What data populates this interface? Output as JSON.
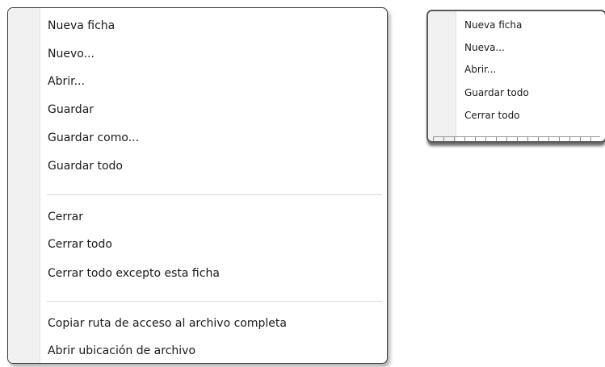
{
  "large_menu": {
    "items": [
      {
        "label": "Nueva ficha"
      },
      {
        "label": "Nuevo..."
      },
      {
        "label": "Abrir..."
      },
      {
        "label": "Guardar"
      },
      {
        "label": "Guardar como..."
      },
      {
        "label": "Guardar todo"
      },
      {
        "label": "Cerrar"
      },
      {
        "label": "Cerrar todo"
      },
      {
        "label": "Cerrar todo excepto esta ficha"
      },
      {
        "label": "Copiar ruta de acceso al archivo completa"
      },
      {
        "label": "Abrir ubicación de archivo"
      }
    ]
  },
  "small_menu": {
    "items": [
      {
        "label": "Nueva ficha"
      },
      {
        "label": "Nueva..."
      },
      {
        "label": "Abrir..."
      },
      {
        "label": "Guardar todo"
      },
      {
        "label": "Cerrar todo"
      }
    ]
  }
}
